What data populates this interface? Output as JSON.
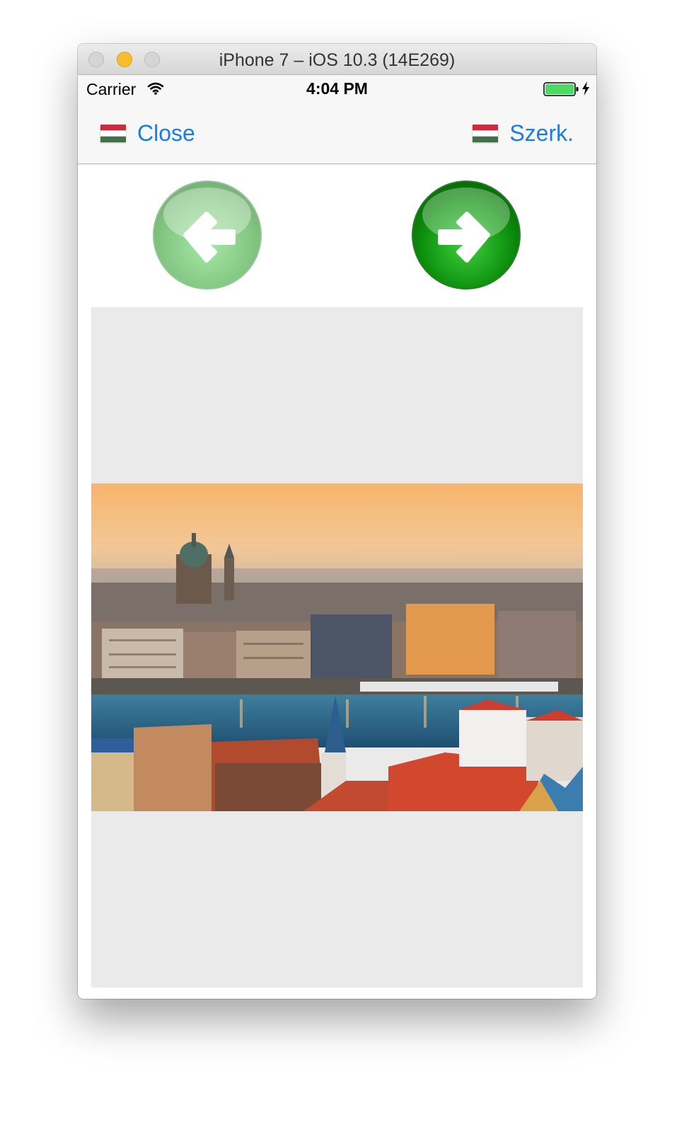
{
  "window": {
    "title": "iPhone 7 – iOS 10.3 (14E269)"
  },
  "statusbar": {
    "carrier": "Carrier",
    "time": "4:04 PM"
  },
  "navbar": {
    "left_label": "Close",
    "right_label": "Szerk."
  },
  "buttons": {
    "previous_icon": "arrow-left-icon",
    "next_icon": "arrow-right-icon"
  },
  "image": {
    "subject": "budapest-cityscape"
  },
  "colors": {
    "accent": "#1a7de6",
    "arrow_green": "#2aa82a",
    "image_background": "#eaeaea"
  }
}
